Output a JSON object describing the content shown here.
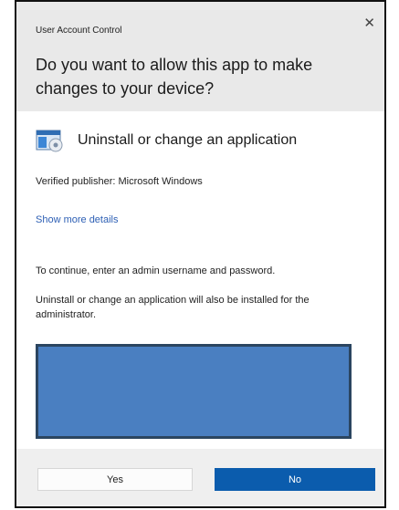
{
  "dialog": {
    "title": "User Account Control",
    "close_glyph": "✕",
    "question": "Do you want to allow this app to make changes to your device?",
    "app": {
      "icon": "application-icon",
      "name": "Uninstall or change an application"
    },
    "publisher": "Verified publisher: Microsoft Windows",
    "show_more": "Show more details",
    "instruction": "To continue, enter an admin username and password.",
    "install_note": "Uninstall or change an application will also be installed for the administrator.",
    "buttons": {
      "yes": "Yes",
      "no": "No"
    },
    "colors": {
      "accent": "#0b5cad",
      "header_bg": "#e9e9e9",
      "link": "#2d5fb4",
      "credential_box": "#4a7fc1"
    }
  }
}
